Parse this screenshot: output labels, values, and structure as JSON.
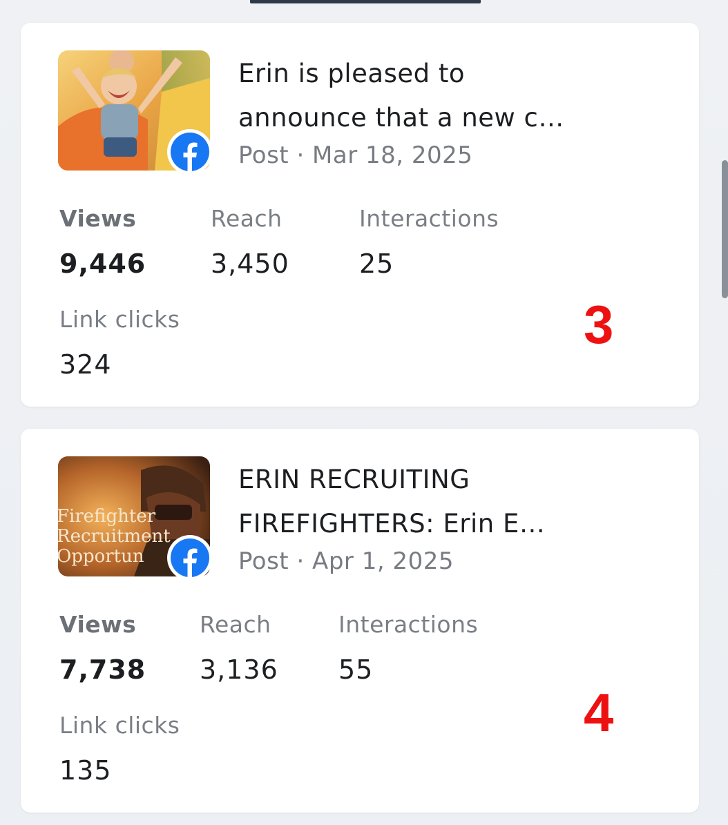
{
  "colors": {
    "accent": "#1877F2",
    "rank": "#EE1111",
    "card": "#FFFFFF",
    "background": "#EEF0F3"
  },
  "posts": [
    {
      "thumbnail": "child-on-slide-photo",
      "platform_icon": "facebook-icon",
      "title_line1": "Erin is pleased to",
      "title_line2": "announce that a new c…",
      "meta": "Post · Mar 18, 2025",
      "metrics": {
        "views_label": "Views",
        "views_value": "9,446",
        "reach_label": "Reach",
        "reach_value": "3,450",
        "interactions_label": "Interactions",
        "interactions_value": "25",
        "link_clicks_label": "Link clicks",
        "link_clicks_value": "324"
      },
      "rank": "3"
    },
    {
      "thumbnail": "firefighter-recruitment-photo",
      "thumbnail_text_line1": "Firefighter",
      "thumbnail_text_line2": "Recruitment",
      "thumbnail_text_line3": "Opportun",
      "platform_icon": "facebook-icon",
      "title_line1": "ERIN RECRUITING",
      "title_line2": "FIREFIGHTERS: Erin E…",
      "meta": "Post · Apr 1, 2025",
      "metrics": {
        "views_label": "Views",
        "views_value": "7,738",
        "reach_label": "Reach",
        "reach_value": "3,136",
        "interactions_label": "Interactions",
        "interactions_value": "55",
        "link_clicks_label": "Link clicks",
        "link_clicks_value": "135"
      },
      "rank": "4"
    }
  ]
}
